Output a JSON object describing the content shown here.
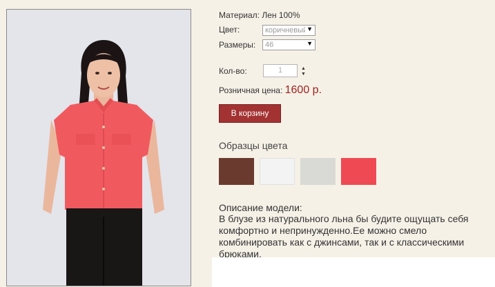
{
  "product": {
    "material_label": "Материал:",
    "material_value": "Лен 100%",
    "color_label": "Цвет:",
    "color_selected": "коричневый",
    "sizes_label": "Размеры:",
    "size_selected": "46",
    "qty_label": "Кол-во:",
    "qty_value": "1",
    "price_label": "Розничная цена:",
    "price_value": "1600 р.",
    "add_to_cart_label": "В корзину"
  },
  "swatches": {
    "title": "Образцы цвета",
    "colors": [
      "#6b3a2e",
      "#f3f3f3",
      "#d9d9d5",
      "#ef4a54"
    ]
  },
  "description": {
    "title": "Описание модели:",
    "text": "В блузе из натурального льна бы будите ощущать себя комфортно и непринужденно.Ее можно смело комбинировать как с джинсами, так и с классическими брюками."
  },
  "colors": {
    "page_bg": "#f6f1e7",
    "accent": "#a33232",
    "price": "#a0211e"
  }
}
